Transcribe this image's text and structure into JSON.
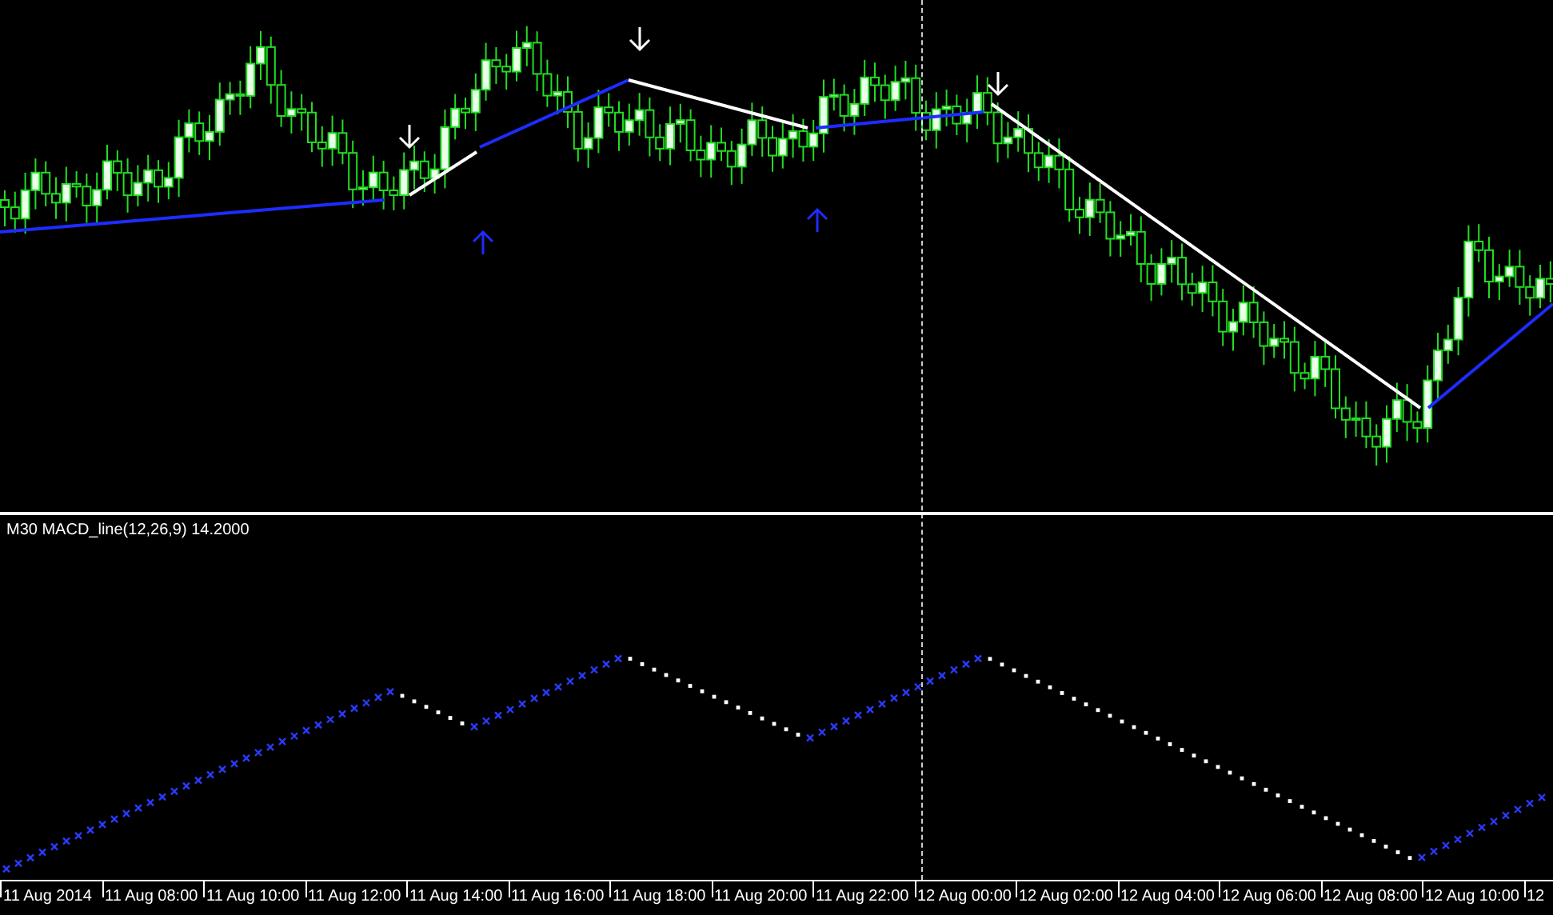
{
  "indicator_panel": {
    "label": "M30 MACD_line(12,26,9) 14.2000"
  },
  "time_axis": {
    "labels": [
      "11 Aug 2014",
      "11 Aug 08:00",
      "11 Aug 10:00",
      "11 Aug 12:00",
      "11 Aug 14:00",
      "11 Aug 16:00",
      "11 Aug 18:00",
      "11 Aug 20:00",
      "11 Aug 22:00",
      "12 Aug 00:00",
      "12 Aug 02:00",
      "12 Aug 04:00",
      "12 Aug 06:00",
      "12 Aug 08:00",
      "12 Aug 10:00",
      "12"
    ]
  }
}
